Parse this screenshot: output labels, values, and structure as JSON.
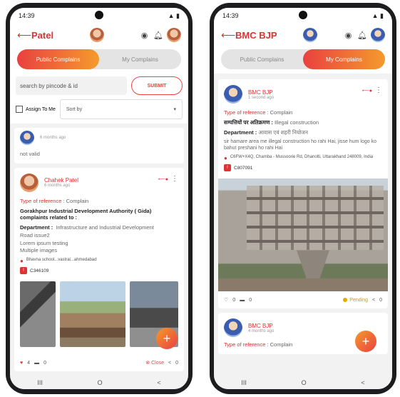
{
  "left": {
    "status_time": "14:39",
    "title": "Patel",
    "tabs": [
      {
        "label": "Public Complains",
        "active": true
      },
      {
        "label": "My Complains",
        "active": false
      }
    ],
    "search_placeholder": "search by pincode & id",
    "submit_label": "SUBMIT",
    "assign_label": "Assign To Me",
    "sort_label": "Sort by",
    "prev_card": {
      "time": "6 months ago",
      "text": "not valid"
    },
    "card": {
      "name": "Chahek Patel",
      "time": "6 months ago",
      "ref_label": "Type of reference :",
      "ref_value": "Complain",
      "subject": "Gorakhpur Industrial Development Authority ( Gida) complaints related to :",
      "dept_label": "Department :",
      "dept_value": "Infrastructure and Industrial Development",
      "desc_lines": [
        "Road issue2",
        "Lorem ipsum testing",
        "Multiple images"
      ],
      "address": "Bhavna school...vastral...ahmedabad",
      "complaint_id": "C346109",
      "likes": "4",
      "comments": "0",
      "status": "Close",
      "shares": "0"
    },
    "nav": [
      "III",
      "O",
      "<"
    ]
  },
  "right": {
    "status_time": "14:39",
    "title": "BMC BJP",
    "tabs": [
      {
        "label": "Public Complains",
        "active": false
      },
      {
        "label": "My Complains",
        "active": true
      }
    ],
    "card": {
      "name": "BMC BJP",
      "time": "1 second ago",
      "ref_label": "Type of reference :",
      "ref_value": "Complain",
      "subject_label": "सम्पत्तियों पर अतिक्रमण :",
      "subject_value": "Illegal construction",
      "dept_label": "Department :",
      "dept_value": "आवास एवं शहरी नियोजन",
      "desc": "sir hamare area me illegal construction ho rahi Hai, jisse hum logo ko bahut preshani ho rahi Hai",
      "address": "C6FW+X4Q, Chamba - Mussoorie Rd, Dhanolti, Uttarakhand 248009, India",
      "complaint_id": "C807091",
      "likes": "0",
      "comments": "0",
      "status": "Pending",
      "shares": "0"
    },
    "card2": {
      "name": "BMC BJP",
      "time": "4 months ago",
      "ref_label": "Type of reference :",
      "ref_value": "Complain"
    },
    "nav": [
      "III",
      "O",
      "<"
    ]
  }
}
